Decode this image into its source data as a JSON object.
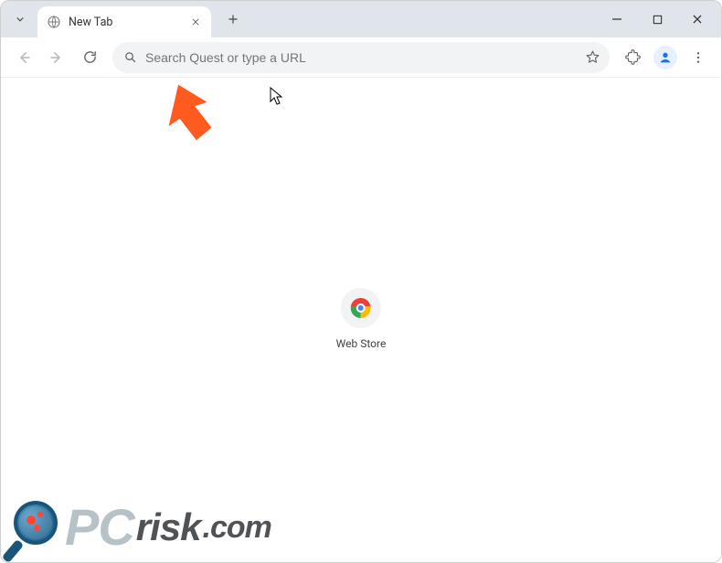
{
  "window": {
    "controls": {
      "minimize": "minimize",
      "maximize": "maximize",
      "close": "close"
    }
  },
  "tabstrip": {
    "tabs": [
      {
        "title": "New Tab",
        "favicon": "globe-icon"
      }
    ]
  },
  "toolbar": {
    "omnibox_placeholder": "Search Quest or type a URL"
  },
  "content": {
    "shortcuts": [
      {
        "label": "Web Store",
        "icon": "chrome-store-icon"
      }
    ]
  },
  "watermark": {
    "pc": "PC",
    "risk": "risk",
    "com": ".com"
  }
}
